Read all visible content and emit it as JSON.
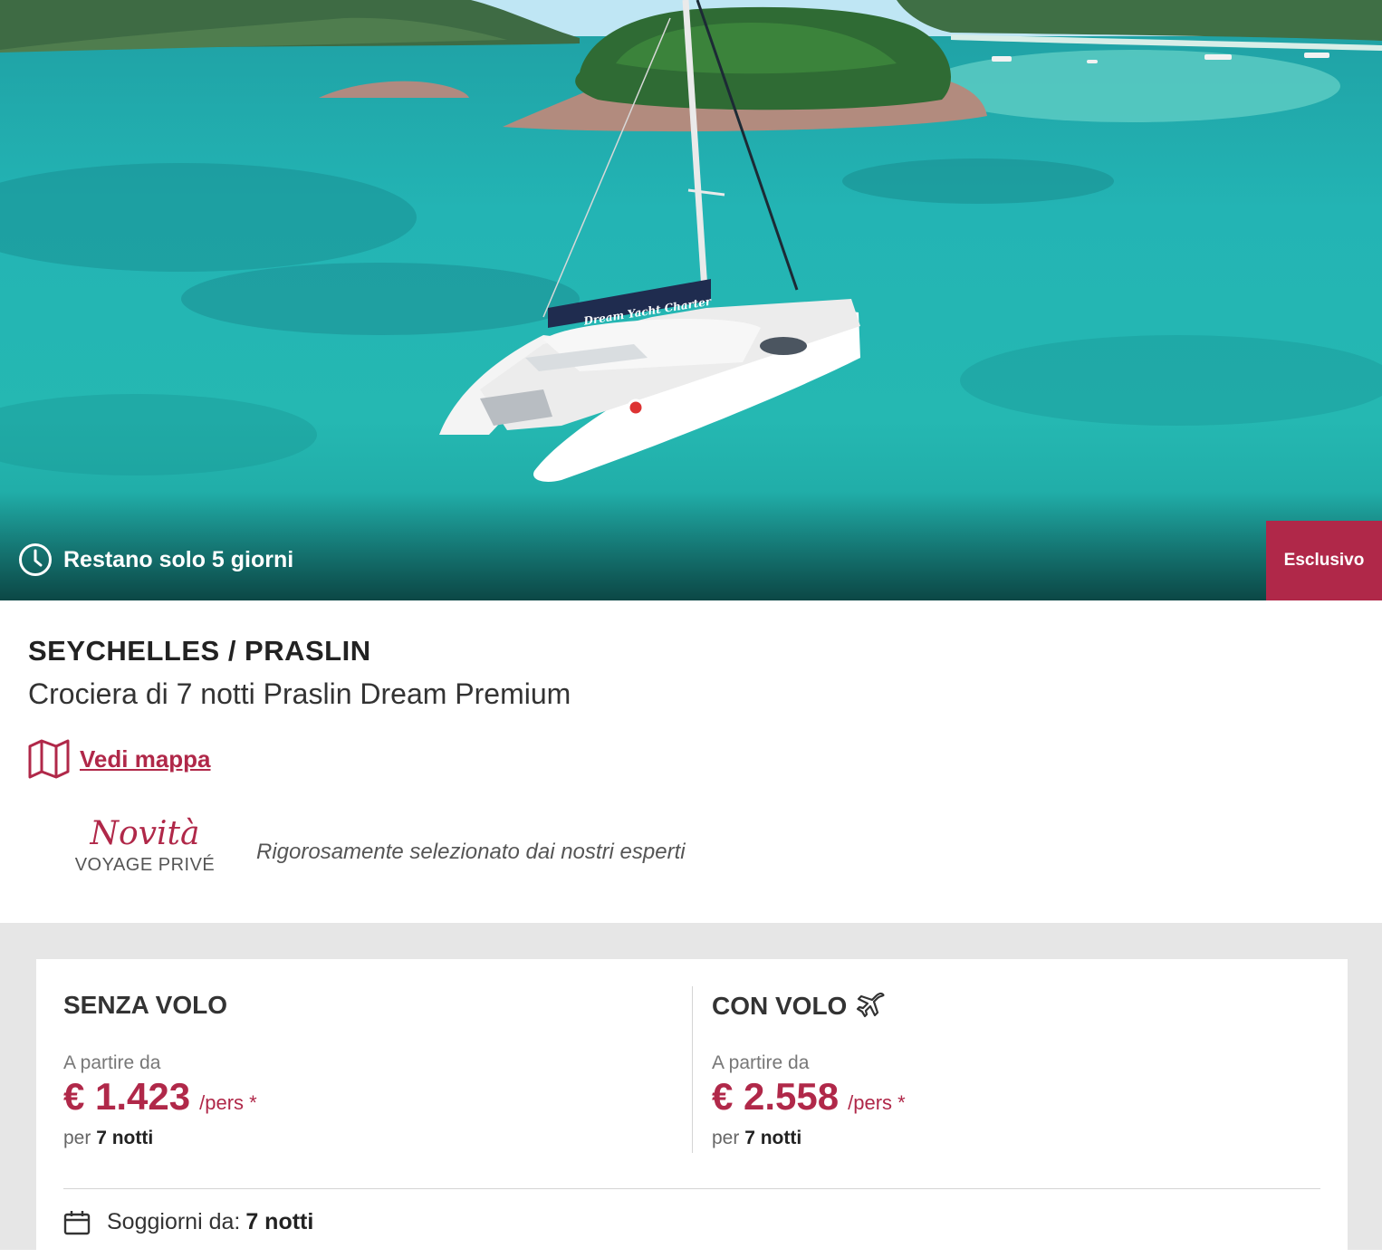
{
  "hero": {
    "image_alt": "catamaran-island-seychelles",
    "boat_banner_text": "Dream Yacht Charter",
    "timer_icon": "clock-icon",
    "timer_text": "Restano solo 5 giorni",
    "badge": "Esclusivo"
  },
  "offer": {
    "destination": "SEYCHELLES / PRASLIN",
    "title": "Crociera di 7 notti Praslin Dream Premium",
    "map_icon": "map-icon",
    "map_link": "Vedi mappa",
    "novita_title": "Novità",
    "novita_sub": "VOYAGE PRIVÉ",
    "tagline": "Rigorosamente selezionato dai nostri esperti"
  },
  "pricing": {
    "without_flight": {
      "title": "SENZA VOLO",
      "from_label": "A partire da",
      "price": "€ 1.423",
      "per_pers": "/pers *",
      "nights_prefix": "per",
      "nights": "7 notti"
    },
    "with_flight": {
      "title": "CON VOLO",
      "icon": "plane-icon",
      "from_label": "A partire da",
      "price": "€ 2.558",
      "per_pers": "/pers *",
      "nights_prefix": "per",
      "nights": "7 notti"
    },
    "stays": {
      "icon": "calendar-icon",
      "label": "Soggiorni da:",
      "value": "7 notti"
    }
  },
  "colors": {
    "accent": "#b02849",
    "sea": "#23b4b4",
    "panel_bg": "#e6e6e6"
  }
}
